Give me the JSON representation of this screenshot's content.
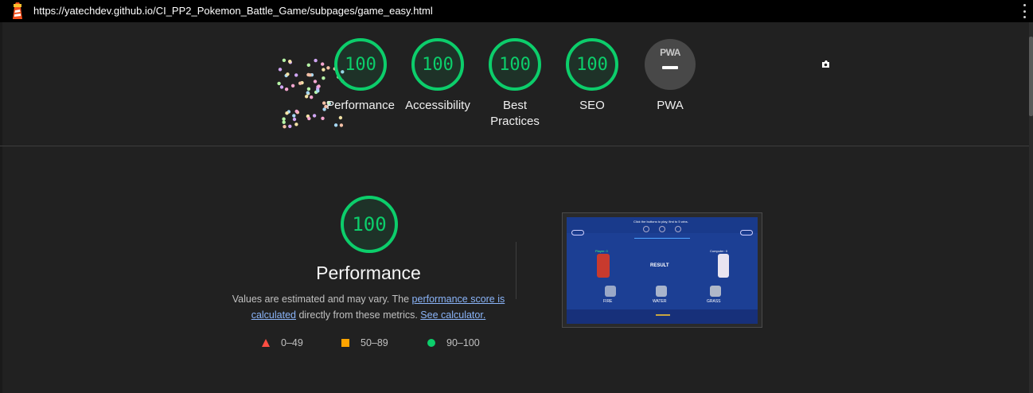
{
  "browser": {
    "url": "https://yatechdev.github.io/CI_PP2_Pokemon_Battle_Game/subpages/game_easy.html",
    "menu_icon": "kebab-icon",
    "logo_icon": "lighthouse-icon"
  },
  "summary": {
    "gauges": [
      {
        "score": "100",
        "label": "Performance"
      },
      {
        "score": "100",
        "label": "Accessibility"
      },
      {
        "score": "100",
        "label": "Best Practices"
      },
      {
        "score": "100",
        "label": "SEO"
      }
    ],
    "pwa": {
      "badge_text": "PWA",
      "label": "PWA"
    }
  },
  "performance": {
    "score": "100",
    "title": "Performance",
    "desc_start": "Values are estimated and may vary. The ",
    "link1": "performance score is calculated",
    "desc_mid": " directly from these metrics. ",
    "link2": "See calculator."
  },
  "legend": [
    {
      "range": "0–49",
      "shape": "triangle",
      "color": "#ff4e42"
    },
    {
      "range": "50–89",
      "shape": "square",
      "color": "#ffa400"
    },
    {
      "range": "90–100",
      "shape": "circle",
      "color": "#0cce6b"
    }
  ],
  "screenshot": {
    "title": "Click the buttons to play, first to 5 wins.",
    "player": "Player: 0",
    "computer": "Computer: 0",
    "result": "RESULT",
    "choices": [
      "FIRE",
      "WATER",
      "GRASS"
    ]
  },
  "colors": {
    "pass": "#0cce6b",
    "average": "#ffa400",
    "fail": "#ff4e42",
    "background": "#212121"
  }
}
